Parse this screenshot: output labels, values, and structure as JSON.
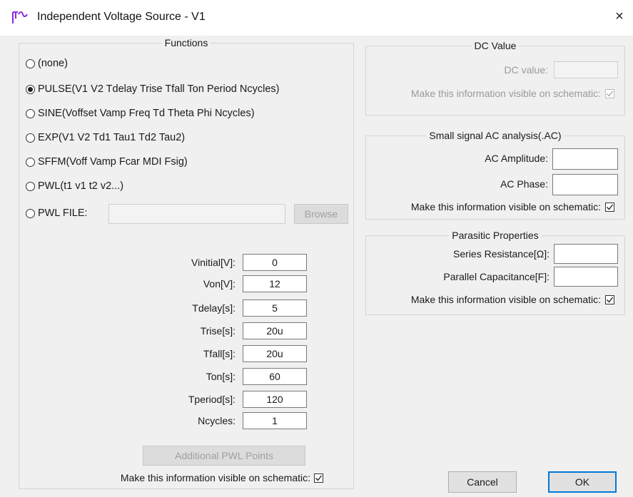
{
  "window": {
    "title": "Independent Voltage Source - V1",
    "close_glyph": "×",
    "icon": "voltage-source-icon"
  },
  "functions": {
    "legend": "Functions",
    "options": [
      {
        "label": "(none)",
        "checked": false
      },
      {
        "label": "PULSE(V1 V2 Tdelay Trise Tfall Ton Period Ncycles)",
        "checked": true
      },
      {
        "label": "SINE(Voffset Vamp Freq Td Theta Phi Ncycles)",
        "checked": false
      },
      {
        "label": "EXP(V1 V2 Td1 Tau1 Td2 Tau2)",
        "checked": false
      },
      {
        "label": "SFFM(Voff Vamp Fcar MDI Fsig)",
        "checked": false
      },
      {
        "label": "PWL(t1 v1 t2 v2...)",
        "checked": false
      },
      {
        "label": "PWL FILE:",
        "checked": false
      }
    ],
    "pwl_file_value": "",
    "browse_label": "Browse",
    "params": [
      {
        "label": "Vinitial[V]:",
        "value": "0"
      },
      {
        "label": "Von[V]:",
        "value": "12"
      },
      {
        "label": "Tdelay[s]:",
        "value": "5"
      },
      {
        "label": "Trise[s]:",
        "value": "20u"
      },
      {
        "label": "Tfall[s]:",
        "value": "20u"
      },
      {
        "label": "Ton[s]:",
        "value": "60"
      },
      {
        "label": "Tperiod[s]:",
        "value": "120"
      },
      {
        "label": "Ncycles:",
        "value": "1"
      }
    ],
    "additional_pwl_label": "Additional PWL Points",
    "visible_label": "Make this information visible on schematic:",
    "visible_checked": true
  },
  "dc": {
    "legend": "DC Value",
    "value_label": "DC value:",
    "value": "",
    "visible_label": "Make this information visible on schematic:",
    "visible_checked": true
  },
  "ac": {
    "legend": "Small signal AC analysis(.AC)",
    "amplitude_label": "AC Amplitude:",
    "amplitude_value": "",
    "phase_label": "AC Phase:",
    "phase_value": "",
    "visible_label": "Make this information visible on schematic:",
    "visible_checked": true
  },
  "parasitic": {
    "legend": "Parasitic Properties",
    "series_label": "Series Resistance[Ω]:",
    "series_value": "",
    "parallel_label": "Parallel Capacitance[F]:",
    "parallel_value": "",
    "visible_label": "Make this information visible on schematic:",
    "visible_checked": true
  },
  "buttons": {
    "cancel": "Cancel",
    "ok": "OK"
  },
  "colors": {
    "accent": "#0078d7",
    "background": "#f0f0f0"
  }
}
